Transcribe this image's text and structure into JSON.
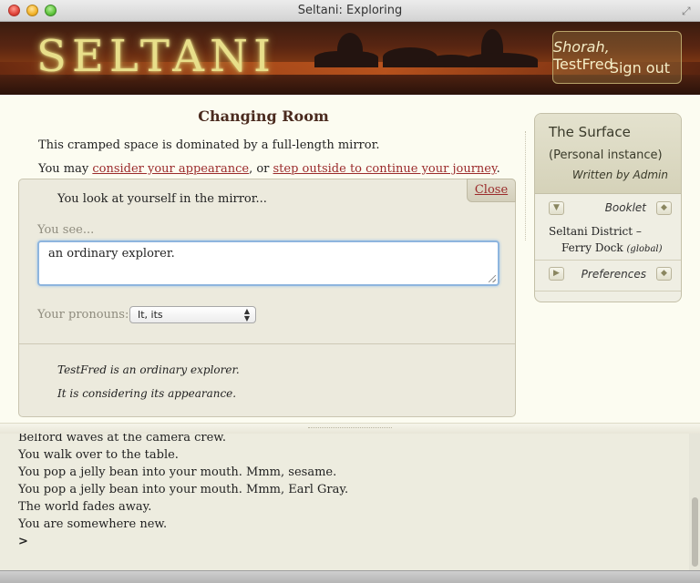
{
  "window": {
    "title": "Seltani: Exploring"
  },
  "banner": {
    "logo": "SELTANI",
    "user_name_italic": "Shorah,",
    "user_name": "TestFred",
    "signout": "Sign out"
  },
  "room": {
    "title": "Changing Room",
    "description": "This cramped space is dominated by a full-length mirror.",
    "choices_prefix": "You may ",
    "link_appearance": "consider your appearance",
    "choices_middle": ", or ",
    "link_outside": "step outside to continue your journey",
    "choices_suffix": "."
  },
  "mirror": {
    "heading": "You look at yourself in the mirror...",
    "close": "Close",
    "you_see_label": "You see...",
    "description_value": "an ordinary explorer.",
    "pronouns_label": "Your pronouns:",
    "pronouns_value": "It, its",
    "result_1": "TestFred is an ordinary explorer.",
    "result_2": "It is considering its appearance."
  },
  "sidebar": {
    "title": "The Surface",
    "subtitle": "(Personal instance)",
    "author": "Written by Admin",
    "booklet_label": "Booklet",
    "location_line1": "Seltani District –",
    "location_line2": "Ferry Dock",
    "location_scope": "(global)",
    "preferences_label": "Preferences"
  },
  "log": {
    "lines": [
      "Belford waves at the camera crew.",
      "You walk over to the table.",
      "You pop a jelly bean into your mouth. Mmm, sesame.",
      "You pop a jelly bean into your mouth. Mmm, Earl Gray.",
      "The world fades away.",
      "You are somewhere new."
    ],
    "prompt": ">"
  }
}
